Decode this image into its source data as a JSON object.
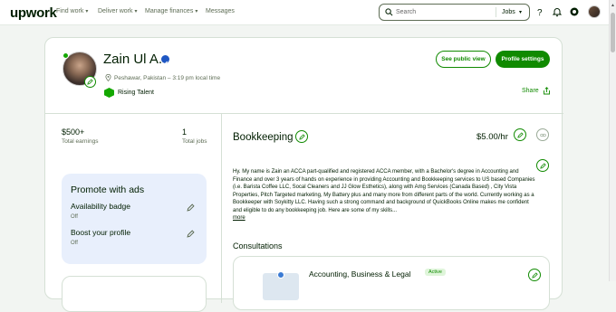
{
  "topbar": {
    "logo": "upwork",
    "nav": [
      {
        "label": "Find work",
        "has_dropdown": true
      },
      {
        "label": "Deliver work",
        "has_dropdown": true
      },
      {
        "label": "Manage finances",
        "has_dropdown": true
      },
      {
        "label": "Messages",
        "has_dropdown": false
      }
    ],
    "search": {
      "placeholder": "Search",
      "scope": "Jobs"
    },
    "icons": [
      "question-icon",
      "bell-icon",
      "settings-icon",
      "avatar"
    ]
  },
  "profile": {
    "name": "Zain Ul A.",
    "verified": true,
    "location": "Peshawar, Pakistan – 3:19 pm local time",
    "badge": "Rising Talent",
    "buttons": {
      "public_view": "See public view",
      "settings": "Profile settings"
    },
    "share": "Share"
  },
  "stats": [
    {
      "value": "$500+",
      "label": "Total earnings"
    },
    {
      "value": "1",
      "label": "Total jobs"
    }
  ],
  "promote": {
    "title": "Promote with ads",
    "items": [
      {
        "label": "Availability badge",
        "status": "Off"
      },
      {
        "label": "Boost your profile",
        "status": "Off"
      }
    ]
  },
  "specialty": {
    "title": "Bookkeeping",
    "rate": "$5.00/hr",
    "bio": "Hy. My name is Zain an ACCA part-qualified and registered ACCA member, with a Bachelor's degree in Accounting and Finance and over 3 years of hands on experience in providing Accounting and Bookkeeping services to US based Companies (i.e. Barista Coffee LLC, Socal Cleaners and JJ Glow Esthetics), along with Amg Services (Canada Based) , City Vista Properties, Pitch Targeted marketing, My Battery plus and many more from different parts of the world. Currently working as a Bookkeeper with Soykitty LLC. Having such a strong command and background of QuickBooks Online makes me confident and eligible to do any bookkeeping job. Here are some of my skills...",
    "more": "more"
  },
  "consultations": {
    "title": "Consultations",
    "items": [
      {
        "name": "Accounting, Business & Legal",
        "status": "Active"
      }
    ]
  },
  "colors": {
    "brand_green": "#108a00",
    "accent_green": "#14a800",
    "promo_bg": "#e8effc",
    "verified_blue": "#1f57c3"
  }
}
